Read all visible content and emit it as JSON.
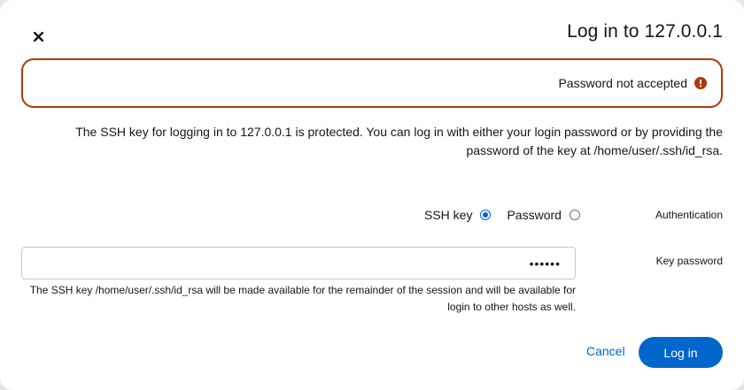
{
  "dialog": {
    "title": "Log in to 127.0.0.1",
    "close_icon": "close-icon"
  },
  "alert": {
    "text": "Password not accepted",
    "icon": "error-icon",
    "border_color": "#b1380b",
    "icon_color": "#b1380b"
  },
  "description": {
    "text": "The SSH key for logging in to 127.0.0.1 is protected. You can log in with either your login password or by providing the password of the key at /home/user/.ssh/id_rsa."
  },
  "authentication": {
    "label": "Authentication",
    "options": [
      {
        "label": "SSH key",
        "checked": true
      },
      {
        "label": "Password",
        "checked": false
      }
    ]
  },
  "key_password": {
    "label": "Key password",
    "value": "••••••",
    "helper": "The SSH key /home/user/.ssh/id_rsa will be made available for the remainder of the session and will be available for login to other hosts as well."
  },
  "actions": {
    "cancel_label": "Cancel",
    "login_label": "Log in"
  },
  "colors": {
    "accent": "#0066cc"
  }
}
